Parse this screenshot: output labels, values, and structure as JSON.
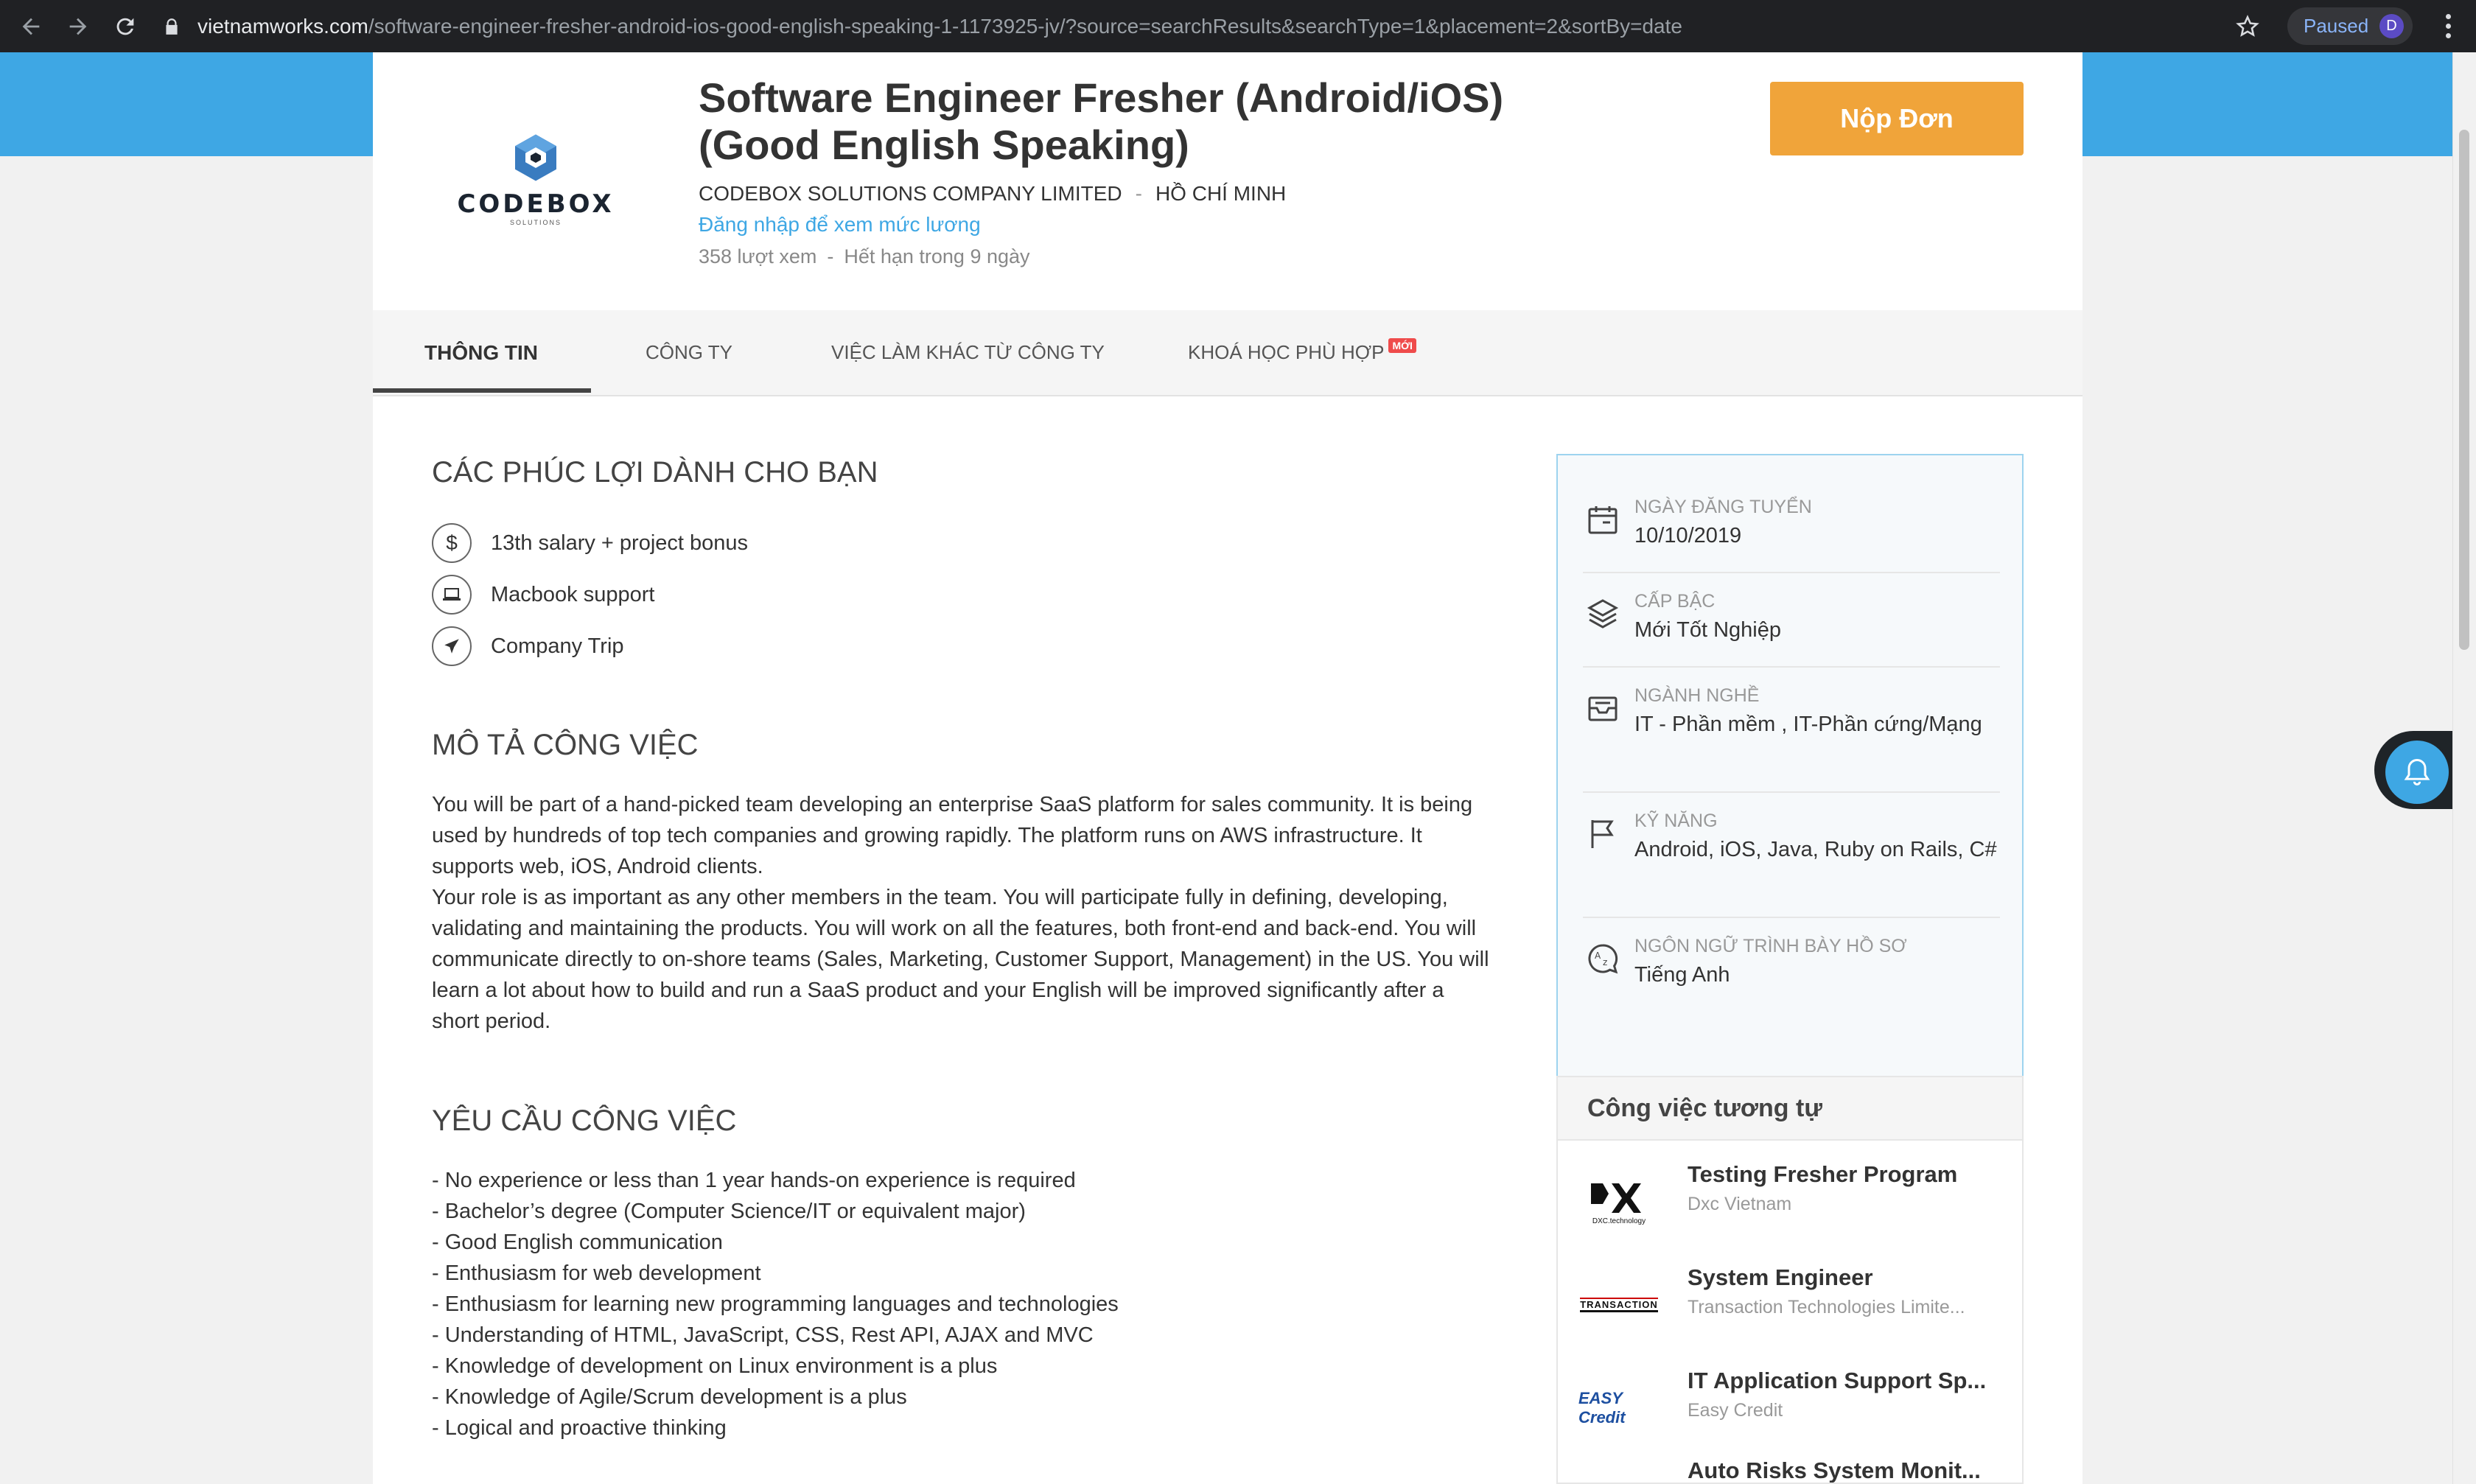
{
  "browser": {
    "url_host": "vietnamworks.com",
    "url_path": "/software-engineer-fresher-android-ios-good-english-speaking-1-1173925-jv/?source=searchResults&searchType=1&placement=2&sortBy=date",
    "profile_status": "Paused",
    "profile_initial": "D"
  },
  "job": {
    "company_logo_text": "CODEBOX",
    "company_logo_sub": "SOLUTIONS",
    "title": "Software Engineer Fresher (Android/iOS) (Good English Speaking)",
    "company": "CODEBOX SOLUTIONS COMPANY LIMITED",
    "separator": "-",
    "location": "HỒ CHÍ MINH",
    "salary_link": "Đăng nhập để xem mức lương",
    "views": "358 lượt xem",
    "expiry": "Hết hạn trong 9 ngày",
    "apply_label": "Nộp Đơn"
  },
  "tabs": [
    {
      "label": "THÔNG TIN"
    },
    {
      "label": "CÔNG TY"
    },
    {
      "label": "VIỆC LÀM KHÁC TỪ CÔNG TY"
    },
    {
      "label": "KHOÁ HỌC PHÙ HỢP",
      "badge": "MỚI"
    }
  ],
  "benefits": {
    "title": "CÁC PHÚC LỢI DÀNH CHO BẠN",
    "items": [
      {
        "label": "13th salary + project bonus",
        "icon": "dollar-icon"
      },
      {
        "label": "Macbook support",
        "icon": "laptop-icon"
      },
      {
        "label": "Company Trip",
        "icon": "plane-icon"
      }
    ]
  },
  "description": {
    "title": "MÔ TẢ CÔNG VIỆC",
    "paragraphs": [
      "You will be part of a hand-picked team developing an enterprise SaaS platform for sales community. It is being used by hundreds of top tech companies and growing rapidly. The platform runs on AWS infrastructure. It supports web, iOS, Android clients.",
      "Your role is as important as any other members in the team. You will participate fully in defining, developing, validating and maintaining the products. You will work on all the features, both front-end and back-end. You will communicate directly to on-shore teams (Sales, Marketing, Customer Support, Management) in the US. You will learn a lot about how to build and run a SaaS product and your English will be improved significantly after a short period."
    ]
  },
  "requirements": {
    "title": "YÊU CẦU CÔNG VIỆC",
    "items": [
      "- No experience or less than 1 year hands-on experience is required",
      "- Bachelor’s degree (Computer Science/IT or equivalent major)",
      "- Good English communication",
      "- Enthusiasm for web development",
      "- Enthusiasm for learning new programming languages and technologies",
      "- Understanding of HTML, JavaScript, CSS, Rest API, AJAX and MVC",
      "- Knowledge of development on Linux environment is a plus",
      "- Knowledge of Agile/Scrum development is a plus",
      "- Logical and proactive thinking"
    ]
  },
  "summary": {
    "items": [
      {
        "label": "NGÀY ĐĂNG TUYỂN",
        "value": "10/10/2019",
        "icon": "calendar-icon"
      },
      {
        "label": "CẤP BẬC",
        "value": "Mới Tốt Nghiệp",
        "icon": "layers-icon"
      },
      {
        "label": "NGÀNH NGHỀ",
        "value": "IT - Phần mềm ,  IT-Phần cứng/Mạng",
        "icon": "inbox-icon"
      },
      {
        "label": "KỸ NĂNG",
        "value": "Android, iOS, Java, Ruby on Rails, C#",
        "icon": "flag-icon"
      },
      {
        "label": "NGÔN NGỮ TRÌNH BÀY HỒ SƠ",
        "value": "Tiếng Anh",
        "icon": "translate-icon"
      }
    ]
  },
  "similar": {
    "title": "Công việc tương tự",
    "items": [
      {
        "title": "Testing Fresher Program",
        "company": "Dxc Vietnam",
        "logo_text": "DXC.technology"
      },
      {
        "title": "System Engineer",
        "company": "Transaction Technologies Limite...",
        "logo_text": "TRANSACTION"
      },
      {
        "title": "IT Application Support Sp...",
        "company": "Easy Credit",
        "logo_text": "EASY Credit"
      },
      {
        "title": "Auto Risks System Monit...",
        "company": "",
        "logo_text": ""
      }
    ]
  },
  "colors": {
    "brand_blue": "#3ea7e4",
    "apply_orange": "#f0a43a",
    "badge_red": "#ef4b4b"
  }
}
